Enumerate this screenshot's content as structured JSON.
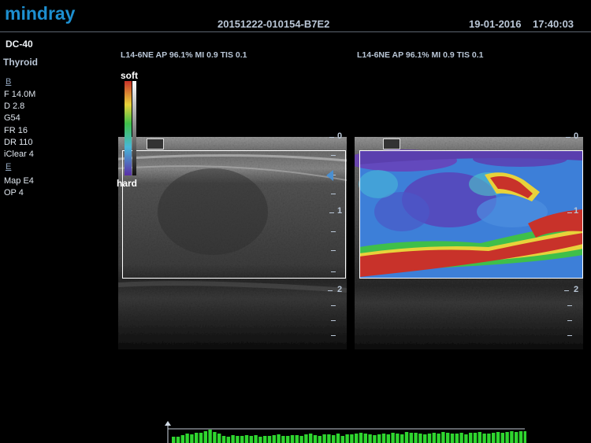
{
  "header": {
    "brand": "mindray",
    "exam_id": "20151222-010154-B7E2",
    "date": "19-01-2016",
    "time": "17:40:03"
  },
  "sidebar": {
    "probe": "DC-40",
    "preset": "Thyroid",
    "mode_b": "B",
    "b_params": [
      "F 14.0M",
      "D 2.8",
      "G54",
      "FR 16",
      "DR 110",
      "iClear 4"
    ],
    "mode_e": "E",
    "e_params": [
      "Map E4",
      "OP 4"
    ]
  },
  "panels": {
    "left_params": "L14-6NE  AP 96.1%  MI 0.9  TIS 0.1",
    "right_params": "L14-6NE  AP 96.1%  MI 0.9  TIS 0.1"
  },
  "colorbar": {
    "top_label": "soft",
    "bottom_label": "hard"
  },
  "depth_scale": {
    "left": [
      "0",
      "1",
      "2"
    ],
    "right": [
      "0",
      "1",
      "2"
    ]
  },
  "histogram": {
    "values": [
      8,
      8,
      10,
      12,
      11,
      13,
      13,
      15,
      17,
      14,
      12,
      9,
      8,
      10,
      9,
      9,
      10,
      9,
      10,
      8,
      9,
      9,
      10,
      11,
      9,
      9,
      10,
      10,
      9,
      11,
      12,
      10,
      9,
      11,
      11,
      10,
      12,
      9,
      11,
      11,
      12,
      13,
      12,
      11,
      10,
      11,
      12,
      11,
      13,
      12,
      11,
      14,
      13,
      13,
      12,
      11,
      12,
      13,
      12,
      14,
      13,
      12,
      12,
      13,
      11,
      13,
      13,
      14,
      12,
      12,
      13,
      14,
      13,
      14,
      15,
      14,
      15,
      15
    ],
    "color": "#2fd62f"
  }
}
